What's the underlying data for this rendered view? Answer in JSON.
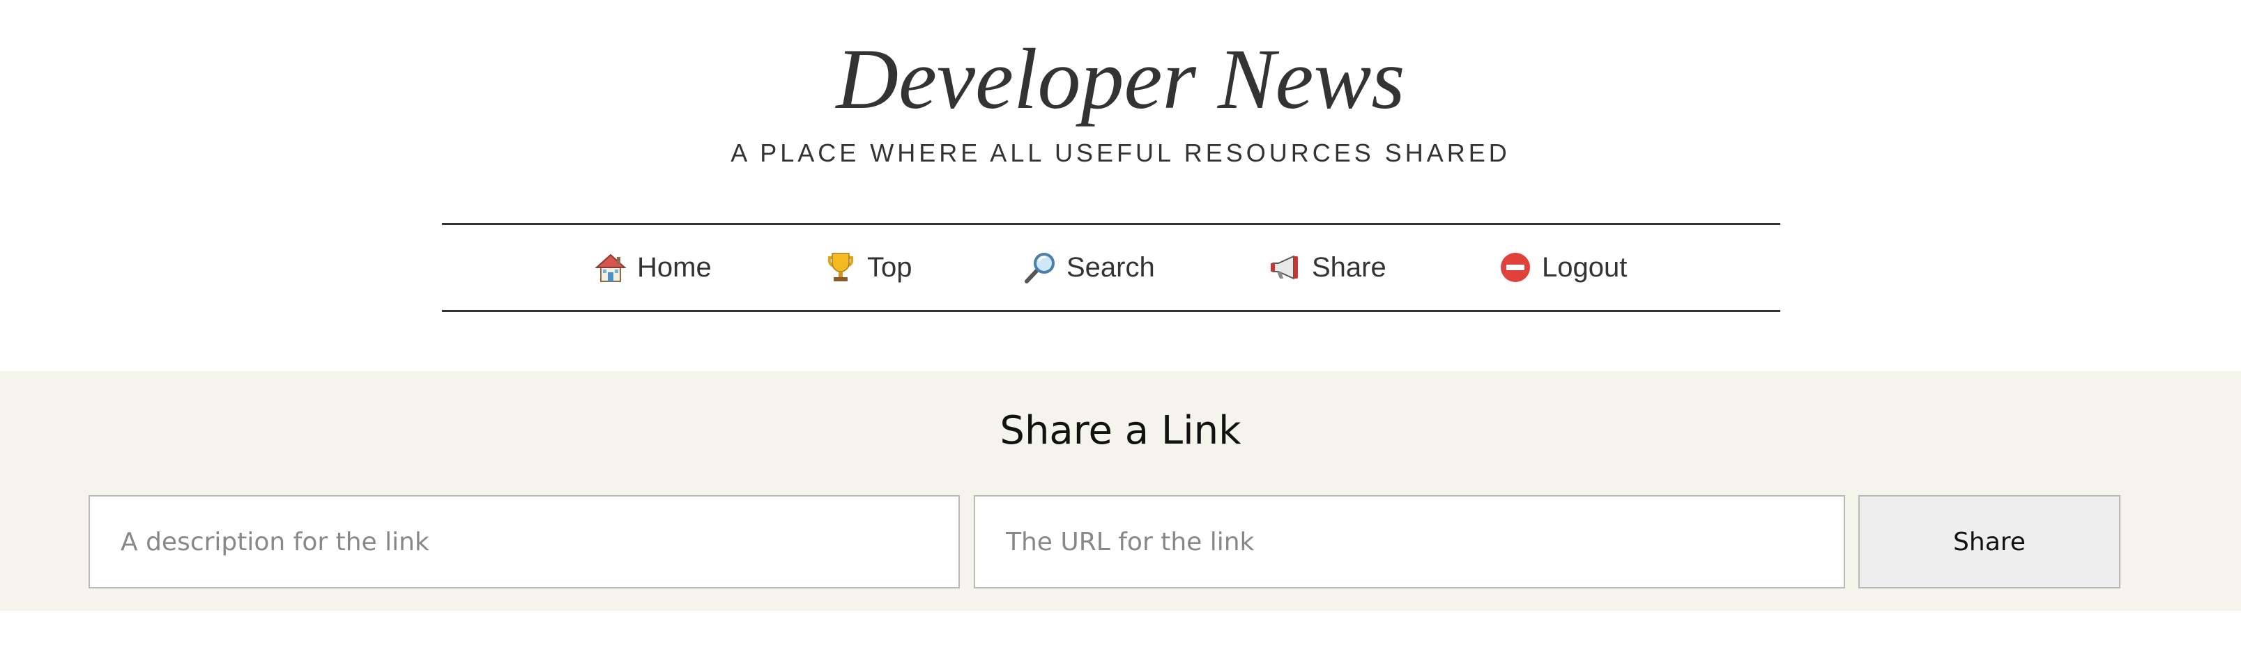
{
  "header": {
    "title": "Developer News",
    "tagline": "A PLACE WHERE ALL USEFUL RESOURCES SHARED"
  },
  "nav": {
    "items": [
      {
        "label": "Home",
        "icon": "house-icon"
      },
      {
        "label": "Top",
        "icon": "trophy-icon"
      },
      {
        "label": "Search",
        "icon": "magnifying-glass-icon"
      },
      {
        "label": "Share",
        "icon": "megaphone-icon"
      },
      {
        "label": "Logout",
        "icon": "no-entry-icon"
      }
    ]
  },
  "share_form": {
    "heading": "Share a Link",
    "description_placeholder": "A description for the link",
    "description_value": "",
    "url_placeholder": "The URL for the link",
    "url_value": "",
    "submit_label": "Share"
  },
  "colors": {
    "text": "#333333",
    "band_background": "#f4f3ec",
    "button_background": "#eeeeee",
    "border": "#b9b9b9"
  }
}
